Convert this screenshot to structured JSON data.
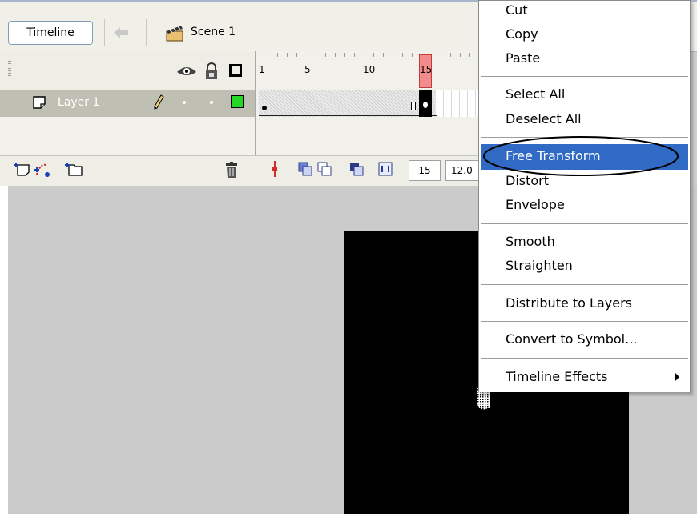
{
  "toolbar": {
    "timeline_button": "Timeline",
    "scene_label": "Scene 1"
  },
  "timeline": {
    "ruler_numbers": [
      "1",
      "5",
      "10",
      "15"
    ],
    "layer_name": "Layer 1",
    "current_frame": "15",
    "frame_rate": "12.0"
  },
  "context_menu": {
    "items": [
      {
        "label": "Cut"
      },
      {
        "label": "Copy"
      },
      {
        "label": "Paste"
      },
      {
        "label": "Select All"
      },
      {
        "label": "Deselect All"
      },
      {
        "label": "Free Transform",
        "highlighted": true
      },
      {
        "label": "Distort"
      },
      {
        "label": "Envelope"
      },
      {
        "label": "Smooth"
      },
      {
        "label": "Straighten"
      },
      {
        "label": "Distribute to Layers"
      },
      {
        "label": "Convert to Symbol..."
      },
      {
        "label": "Timeline Effects",
        "has_submenu": true
      }
    ]
  },
  "colors": {
    "highlight": "#316ac5",
    "layer_outline_color": "#26d826",
    "playhead": "#d42b2b"
  }
}
